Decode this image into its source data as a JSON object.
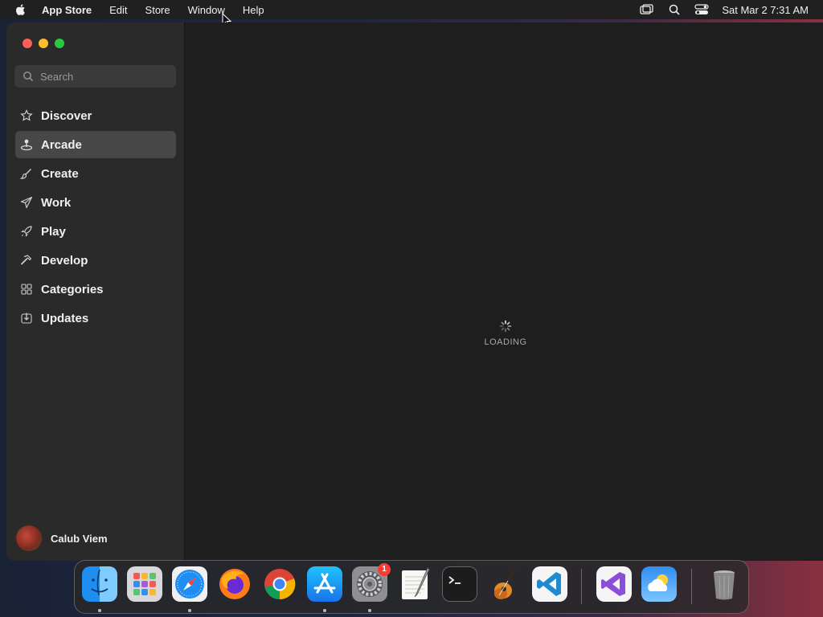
{
  "menubar": {
    "app_name": "App Store",
    "items": [
      "Edit",
      "Store",
      "Window",
      "Help"
    ],
    "clock": "Sat Mar 2  7:31 AM"
  },
  "sidebar": {
    "search_placeholder": "Search",
    "items": [
      {
        "label": "Discover",
        "icon": "star-icon",
        "active": false
      },
      {
        "label": "Arcade",
        "icon": "joystick-icon",
        "active": true
      },
      {
        "label": "Create",
        "icon": "brush-icon",
        "active": false
      },
      {
        "label": "Work",
        "icon": "paper-plane-icon",
        "active": false
      },
      {
        "label": "Play",
        "icon": "rocket-icon",
        "active": false
      },
      {
        "label": "Develop",
        "icon": "hammer-icon",
        "active": false
      },
      {
        "label": "Categories",
        "icon": "grid-icon",
        "active": false
      },
      {
        "label": "Updates",
        "icon": "download-icon",
        "active": false
      }
    ],
    "user_name": "Calub Viem"
  },
  "content": {
    "loading_text": "LOADING"
  },
  "dock": {
    "apps": [
      "Finder",
      "Launchpad",
      "Safari",
      "Firefox",
      "Chrome",
      "App Store",
      "System Settings",
      "TextEdit",
      "Terminal",
      "GarageBand",
      "Visual Studio Code",
      "Visual Studio",
      "Weather",
      "Trash"
    ],
    "settings_badge": "1"
  },
  "colors": {
    "close": "#fe5f57",
    "minimize": "#febc2e",
    "maximize": "#28c840",
    "sidebar_bg": "#2a2a2a",
    "content_bg": "#1e1e1e",
    "active_item_bg": "#474747",
    "badge": "#ff3b30"
  }
}
